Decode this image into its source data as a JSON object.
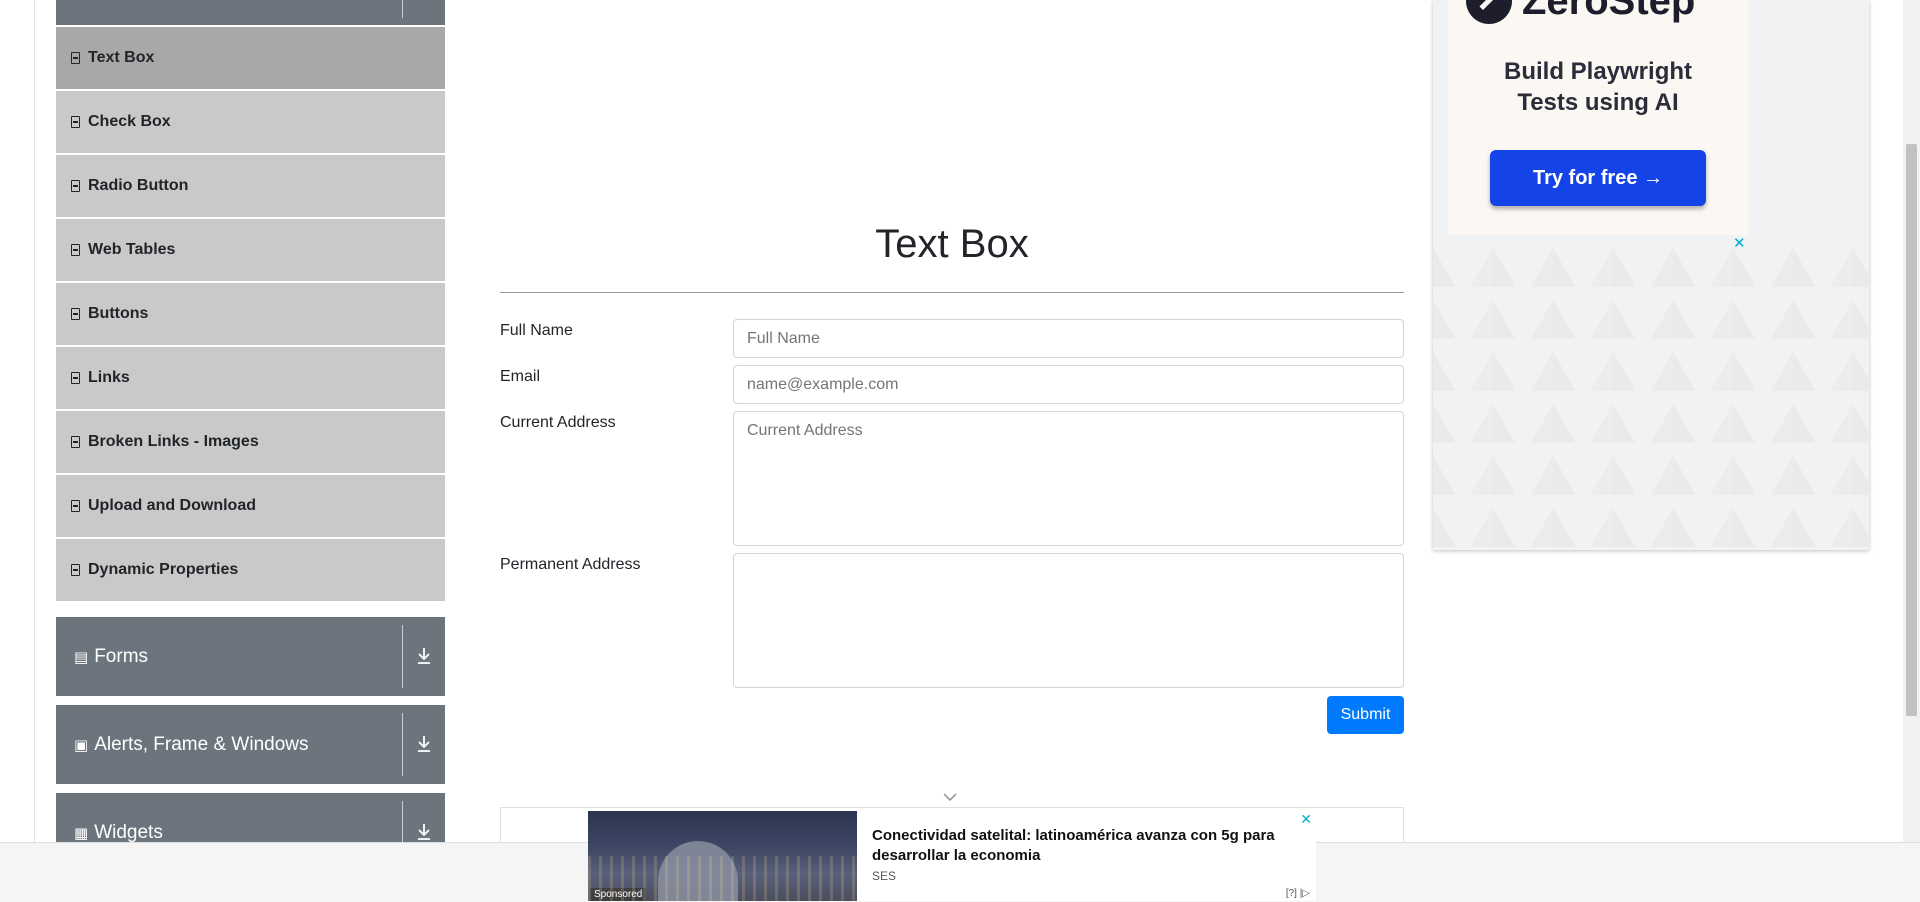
{
  "sidebar": {
    "items": [
      {
        "label": "Text Box"
      },
      {
        "label": "Check Box"
      },
      {
        "label": "Radio Button"
      },
      {
        "label": "Web Tables"
      },
      {
        "label": "Buttons"
      },
      {
        "label": "Links"
      },
      {
        "label": "Broken Links - Images"
      },
      {
        "label": "Upload and Download"
      },
      {
        "label": "Dynamic Properties"
      }
    ],
    "groups": [
      {
        "label": "Forms"
      },
      {
        "label": "Alerts, Frame & Windows"
      },
      {
        "label": "Widgets"
      }
    ]
  },
  "main": {
    "title": "Text Box",
    "full_name": {
      "label": "Full Name",
      "placeholder": "Full Name"
    },
    "email": {
      "label": "Email",
      "placeholder": "name@example.com"
    },
    "current_address": {
      "label": "Current Address",
      "placeholder": "Current Address"
    },
    "permanent_address": {
      "label": "Permanent Address",
      "placeholder": ""
    },
    "submit_label": "Submit"
  },
  "ad_right": {
    "brand": "ZeroStep",
    "headline_line1": "Build Playwright",
    "headline_line2": "Tests using AI",
    "cta": "Try for free →",
    "close": "✕"
  },
  "banner": {
    "title": "Conectividad satelital: latinoamérica avanza con 5g para desarrollar la economia",
    "source": "SES",
    "sponsored": "Sponsored",
    "close": "✕",
    "adinfo": "[?] |▷"
  },
  "colors": {
    "primary": "#007bff",
    "group_header": "#6c757d",
    "menu_item": "#c9c9c9",
    "menu_item_active": "#a8a8a8",
    "ad_cta": "#1443e8"
  }
}
